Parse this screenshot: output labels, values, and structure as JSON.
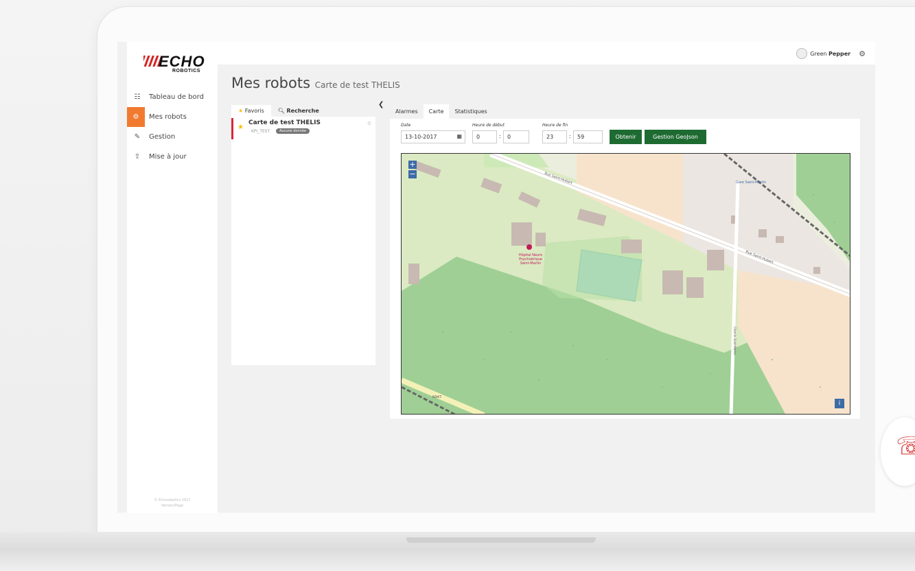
{
  "brand": {
    "logo_text": "ECHO",
    "logo_sub": "ROBOTICS"
  },
  "sidebar": {
    "items": [
      {
        "label": "Tableau de bord",
        "icon": "grid-icon",
        "glyph": "☷"
      },
      {
        "label": "Mes robots",
        "icon": "robots-icon",
        "glyph": "⚙"
      },
      {
        "label": "Gestion",
        "icon": "wrench-icon",
        "glyph": "🔧"
      },
      {
        "label": "Mise à jour",
        "icon": "upload-icon",
        "glyph": "⇧"
      }
    ],
    "copyright_line1": "© Echorobotics 2017",
    "copyright_line2": "Version/Page"
  },
  "topbar": {
    "user_first": "Green ",
    "user_last": "Pepper"
  },
  "page": {
    "title": "Mes robots",
    "subtitle": "Carte de test THELIS"
  },
  "robots_panel": {
    "tabs": [
      "Favoris",
      "Recherche"
    ],
    "robot": {
      "name": "Carte de test THELIS",
      "id": "KPI_TEST",
      "badge": "Aucune donnée"
    }
  },
  "main_tabs": [
    "Alarmes",
    "Carte",
    "Statistiques"
  ],
  "filters": {
    "date_label": "Date",
    "date_value": "13-10-2017",
    "start_label": "Heure de début",
    "start_h": "0",
    "start_m": "0",
    "end_label": "Heure de fin",
    "end_h": "23",
    "end_m": "59",
    "colon": ":"
  },
  "buttons": {
    "get": "Obtenir",
    "geojson": "Gestion GeoJson"
  },
  "map": {
    "zoom_in": "+",
    "zoom_out": "−",
    "info": "i",
    "labels": {
      "street1": "Rue Saint-Hubert",
      "street2": "Rue Saint-Hubert",
      "place": "Gare Saint-Martin",
      "poi": "Hôpital Neuro Psychiatrique Saint-Martin",
      "road": "N947",
      "path": "Chemin Saint-Martin"
    }
  }
}
